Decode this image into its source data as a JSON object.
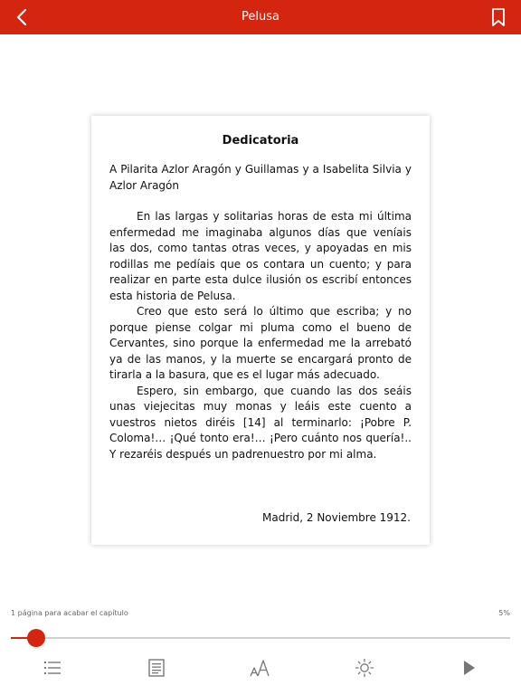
{
  "header": {
    "title": "Pelusa",
    "back_icon": "chevron-left-icon",
    "bookmark_icon": "bookmark-icon",
    "background_color": "#d4260f"
  },
  "page": {
    "heading": "Dedicatoria",
    "dedicatee": "A Pilarita Azlor Aragón y Guillamas y a Isabelita Silvia y Azlor Aragón",
    "paragraphs": [
      "En las largas y solitarias horas de esta mi última enfermedad me imaginaba algunos días que veníais las dos, como tantas otras veces, y apoyadas en mis rodillas me pedíais que os contara un cuento; y para realizar en parte esta dulce ilusión os escribí entonces esta historia de Pelusa.",
      "Creo que esto será lo último que escriba; y no porque piense colgar mi pluma como el bueno de Cervantes, sino porque la enfermedad me la arrebató ya de las manos, y la muerte se encargará pronto de tirarla a la basura, que es el lugar más adecuado.",
      "Espero, sin embargo, que cuando las dos seáis unas viejecitas muy monas y leáis este cuento a vuestros nietos diréis [14] al terminarlo: ¡Pobre P. Coloma!… ¡Qué tonto era!… ¡Pero cuánto nos quería!.. Y rezaréis después un padrenuestro por mi alma."
    ],
    "signature": "Madrid, 2 Noviembre 1912."
  },
  "progress": {
    "chapter_text": "1 página para acabar el capítulo",
    "percent_label": "5%",
    "value": 0.05,
    "accent_color": "#d4260f"
  },
  "toolbar": {
    "items": [
      {
        "icon": "table-of-contents-icon"
      },
      {
        "icon": "page-list-icon"
      },
      {
        "icon": "font-size-icon"
      },
      {
        "icon": "brightness-icon"
      },
      {
        "icon": "play-icon"
      }
    ]
  }
}
